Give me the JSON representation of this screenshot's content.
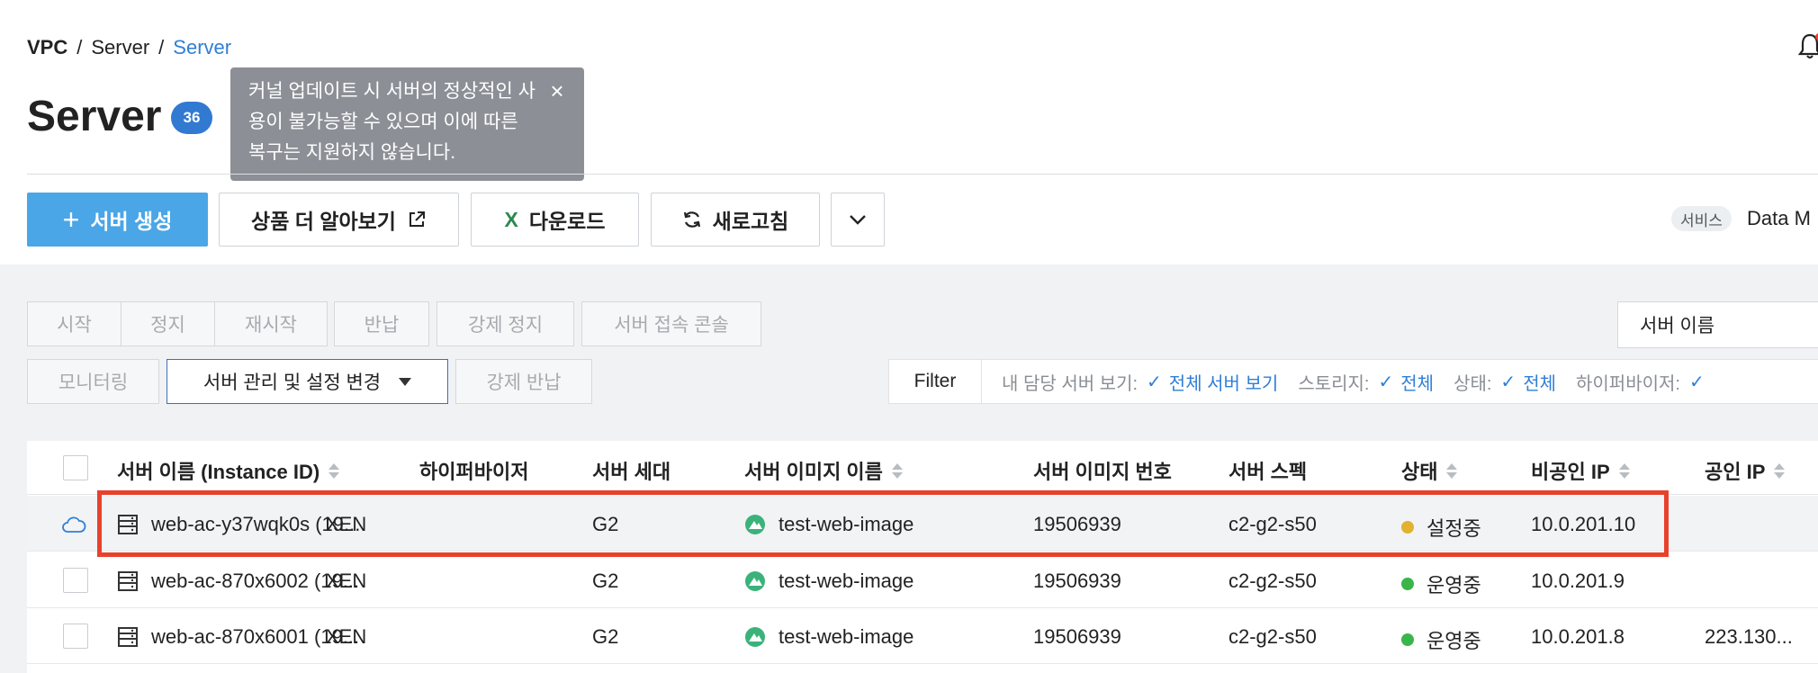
{
  "breadcrumb": {
    "root": "VPC",
    "sep1": "/",
    "mid": "Server",
    "sep2": "/",
    "current": "Server"
  },
  "page": {
    "title": "Server",
    "count": "36"
  },
  "tooltip": {
    "text": "커널 업데이트 시 서버의 정상적인 사용이 불가능할 수 있으며 이에 따른 복구는 지원하지 않습니다.",
    "close": "×"
  },
  "toolbar": {
    "create": "서버 생성",
    "learn_more": "상품 더 알아보기",
    "download_icon": "X",
    "download": "다운로드",
    "refresh": "새로고침"
  },
  "service": {
    "tag": "서비스",
    "text": "Data M"
  },
  "actions": {
    "start": "시작",
    "stop": "정지",
    "restart": "재시작",
    "return": "반납",
    "force_stop": "강제 정지",
    "console": "서버 접속 콘솔",
    "monitoring": "모니터링",
    "manage": "서버 관리 및 설정 변경",
    "force_return": "강제 반납"
  },
  "search": {
    "selected": "서버 이름"
  },
  "filter": {
    "label": "Filter",
    "items": [
      {
        "label": "내 담당 서버 보기:",
        "value": "전체 서버 보기"
      },
      {
        "label": "스토리지:",
        "value": "전체"
      },
      {
        "label": "상태:",
        "value": "전체"
      },
      {
        "label": "하이퍼바이저:",
        "value": ""
      }
    ]
  },
  "table": {
    "headers": {
      "name": "서버 이름 (Instance ID)",
      "hypervisor": "하이퍼바이저",
      "generation": "서버 세대",
      "image_name": "서버 이미지 이름",
      "image_no": "서버 이미지 번호",
      "spec": "서버 스펙",
      "status": "상태",
      "private_ip": "비공인 IP",
      "public_ip": "공인 IP"
    },
    "rows": [
      {
        "name": "web-ac-y37wqk0s (19...",
        "hypervisor": "XEN",
        "generation": "G2",
        "image_name": "test-web-image",
        "image_no": "19506939",
        "spec": "c2-g2-s50",
        "status": "설정중",
        "status_color": "#e0b230",
        "private_ip": "10.0.201.10",
        "public_ip": ""
      },
      {
        "name": "web-ac-870x6002 (19...",
        "hypervisor": "XEN",
        "generation": "G2",
        "image_name": "test-web-image",
        "image_no": "19506939",
        "spec": "c2-g2-s50",
        "status": "운영중",
        "status_color": "#3bb54a",
        "private_ip": "10.0.201.9",
        "public_ip": ""
      },
      {
        "name": "web-ac-870x6001 (19...",
        "hypervisor": "XEN",
        "generation": "G2",
        "image_name": "test-web-image",
        "image_no": "19506939",
        "spec": "c2-g2-s50",
        "status": "운영중",
        "status_color": "#3bb54a",
        "private_ip": "10.0.201.8",
        "public_ip": "223.130..."
      }
    ]
  },
  "colors": {
    "accent": "#2f7fd6",
    "primary_button": "#4aa6e6",
    "highlight": "#e8412c",
    "badge": "#3279d2"
  },
  "icons": [
    "bell-icon",
    "close-icon",
    "plus-icon",
    "external-link-icon",
    "excel-icon",
    "refresh-icon",
    "chevron-down-icon",
    "check-icon",
    "server-icon",
    "cloud-icon",
    "image-os-icon",
    "sort-icon"
  ]
}
